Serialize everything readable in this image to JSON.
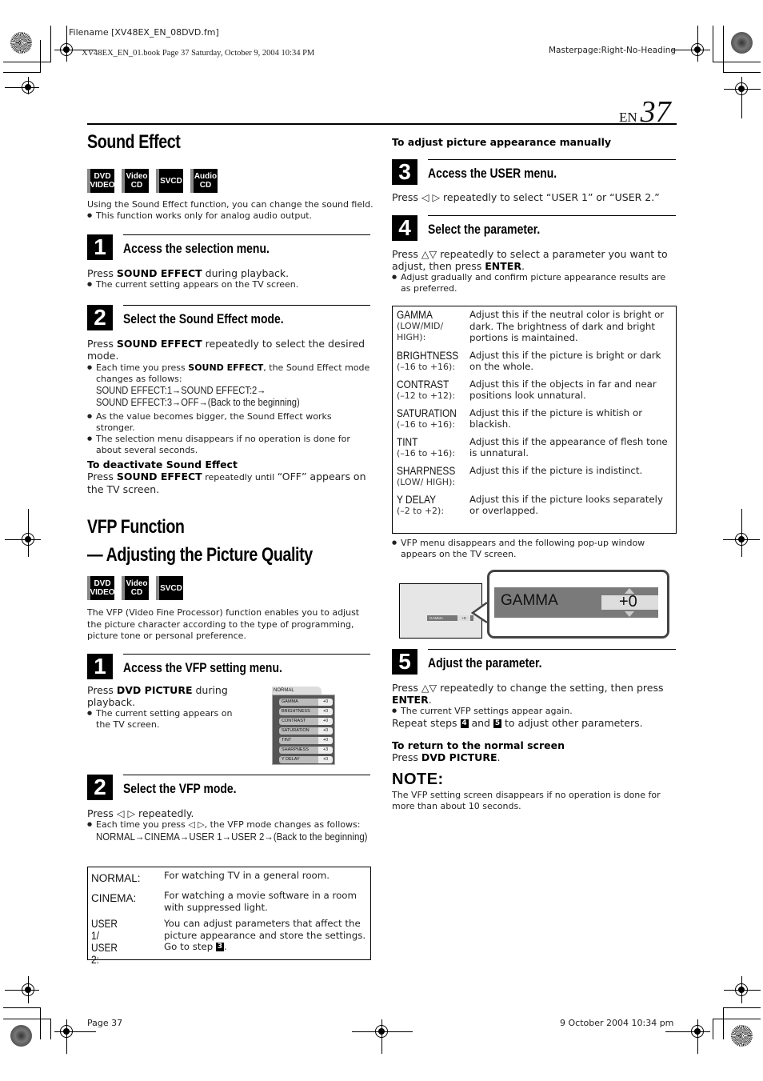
{
  "print_header": {
    "filename": "Filename [XV48EX_EN_08DVD.fm]",
    "book_info": "XV48EX_EN_01.book  Page 37  Saturday, October 9, 2004  10:34 PM",
    "masterpage": "Masterpage:Right-No-Heading"
  },
  "page_label": {
    "lang": "EN",
    "number": "37"
  },
  "sound_effect": {
    "title": "Sound Effect",
    "badges": [
      {
        "line1": "DVD",
        "line2": "VIDEO"
      },
      {
        "line1": "Video",
        "line2": "CD"
      },
      {
        "line1": "SVCD",
        "line2": ""
      },
      {
        "line1": "Audio",
        "line2": "CD"
      }
    ],
    "intro": "Using the Sound Effect function, you can change the sound field.",
    "intro_bullet": "This function works only for analog audio output.",
    "step1": {
      "num": "1",
      "title": "Access the selection menu.",
      "text_pre": "Press ",
      "text_bold": "SOUND EFFECT",
      "text_post": " during playback.",
      "bullet": "The current setting appears on the TV screen."
    },
    "step2": {
      "num": "2",
      "title": "Select the Sound Effect mode.",
      "text_pre": "Press ",
      "text_bold": "SOUND EFFECT",
      "text_post": " repeatedly to select the desired mode.",
      "bullet1_pre": "Each time you press ",
      "bullet1_bold": "SOUND EFFECT",
      "bullet1_post": ", the Sound Effect mode changes as follows:",
      "sequence_line1": "SOUND EFFECT:1→SOUND EFFECT:2→",
      "sequence_line2": "SOUND EFFECT:3→OFF→(Back to the beginning)",
      "bullet2": "As the value becomes bigger, the Sound Effect works stronger.",
      "bullet3": "The selection menu disappears if no operation is done for about several seconds."
    },
    "deactivate": {
      "heading": "To deactivate Sound Effect",
      "text_pre": "Press ",
      "text_bold": "SOUND EFFECT",
      "text_mid": " repeatedly until ",
      "text_post": "“OFF” appears on the TV screen."
    }
  },
  "vfp": {
    "title_line1": "VFP Function",
    "title_line2": "— Adjusting the Picture Quality",
    "badges": [
      {
        "line1": "DVD",
        "line2": "VIDEO"
      },
      {
        "line1": "Video",
        "line2": "CD"
      },
      {
        "line1": "SVCD",
        "line2": ""
      }
    ],
    "intro": "The VFP (Video Fine Processor) function enables you to adjust the picture character according to the type of programming, picture tone or personal preference.",
    "step1": {
      "num": "1",
      "title": "Access the VFP setting menu.",
      "text_pre": "Press ",
      "text_bold": "DVD PICTURE",
      "text_post": " during playback.",
      "bullet": "The current setting appears on the TV screen.",
      "osd": {
        "mode": "NORMAL",
        "rows": [
          {
            "name": "GAMMA",
            "value": "+0"
          },
          {
            "name": "BRIGHTNESS",
            "value": "+0"
          },
          {
            "name": "CONTRAST",
            "value": "+0"
          },
          {
            "name": "SATURATION",
            "value": "+0"
          },
          {
            "name": "TINT",
            "value": "+0"
          },
          {
            "name": "SHARPNESS",
            "value": "+3"
          },
          {
            "name": "Y DELAY",
            "value": "+0"
          }
        ]
      }
    },
    "step2": {
      "num": "2",
      "title": "Select the VFP mode.",
      "text": "Press ◁ ▷ repeatedly.",
      "bullet": "Each time you press ◁ ▷, the VFP mode changes as follows:",
      "sequence": "NORMAL→CINEMA→USER 1→USER 2→(Back to the beginning)",
      "modes": [
        {
          "key": "NORMAL:",
          "desc": "For watching TV in a general room."
        },
        {
          "key": "CINEMA:",
          "desc": "For watching a movie software in a room with suppressed light."
        },
        {
          "key": "USER 1/ USER 2:",
          "desc": "You can adjust parameters that affect the picture appearance and store the settings. Go to step",
          "step_ref": "3"
        }
      ]
    },
    "manual_heading": "To adjust picture appearance manually",
    "step3": {
      "num": "3",
      "title": "Access the USER menu.",
      "text": "Press ◁ ▷ repeatedly to select “USER 1” or “USER 2.”"
    },
    "step4": {
      "num": "4",
      "title": "Select the parameter.",
      "text_pre": "Press △▽ repeatedly to select a parameter you want to adjust, then press ",
      "text_bold": "ENTER",
      "text_post": ".",
      "bullet": "Adjust gradually and confirm picture appearance results are as preferred.",
      "params": [
        {
          "key": "GAMMA",
          "range": "(LOW/MID/ HIGH):",
          "desc": "Adjust this if the neutral color is bright or dark. The brightness of dark and bright portions is maintained."
        },
        {
          "key": "BRIGHTNESS",
          "range": "(–16 to +16):",
          "desc": "Adjust this if the picture is bright or dark on the whole."
        },
        {
          "key": "CONTRAST",
          "range": "(–12 to +12):",
          "desc": "Adjust this if the objects in far and near positions look unnatural."
        },
        {
          "key": "SATURATION",
          "range": "(–16 to +16):",
          "desc": "Adjust this if the picture is whitish or blackish."
        },
        {
          "key": "TINT",
          "range": "(–16 to +16):",
          "desc": "Adjust this if the appearance of flesh tone is unnatural."
        },
        {
          "key": "SHARPNESS",
          "range": "(LOW/ HIGH):",
          "desc": "Adjust this if the picture is indistinct."
        },
        {
          "key": "Y DELAY",
          "range": "(–2 to +2):",
          "desc": "Adjust this if the picture looks separately or overlapped."
        }
      ],
      "popup_bullet": "VFP menu disappears and the following pop-up window appears on the TV screen.",
      "popup": {
        "label": "GAMMA",
        "value": "+0"
      }
    },
    "step5": {
      "num": "5",
      "title": "Adjust the parameter.",
      "text_pre": "Press △▽ repeatedly to change the setting, then press ",
      "text_bold": "ENTER",
      "text_post": ".",
      "bullet": "The current VFP settings appear again.",
      "repeat_pre": "Repeat steps ",
      "repeat_a": "4",
      "repeat_mid": " and ",
      "repeat_b": "5",
      "repeat_post": " to adjust other parameters."
    },
    "return": {
      "heading": "To return to the normal screen",
      "text_pre": "Press ",
      "text_bold": "DVD PICTURE",
      "text_post": "."
    },
    "note": {
      "title": "NOTE:",
      "text": "The VFP setting screen disappears if no operation is done for more than about 10 seconds."
    }
  },
  "print_footer": {
    "page": "Page 37",
    "date": "9 October 2004 10:34 pm"
  }
}
